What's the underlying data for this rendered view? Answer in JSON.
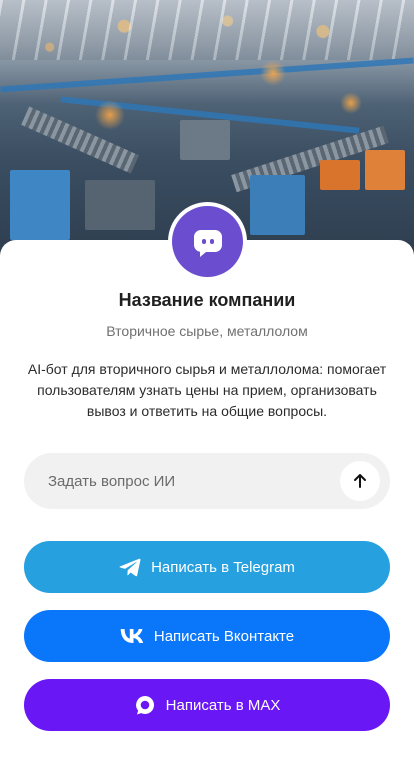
{
  "hero": {
    "image_alt": "Recycling plant"
  },
  "company": {
    "name": "Название компании",
    "category": "Вторичное сырье, металлолом",
    "description": "AI-бот для вторичного сырья и металлолома: помогает пользователям узнать цены на прием, организовать вывоз и ответить на общие вопросы."
  },
  "ask": {
    "placeholder": "Задать вопрос ИИ",
    "value": ""
  },
  "buttons": {
    "telegram": {
      "label": "Написать в Telegram",
      "color": "#27a0df",
      "icon": "telegram-icon"
    },
    "vk": {
      "label": "Написать Вконтакте",
      "color": "#0a77fb",
      "icon": "vk-icon"
    },
    "max": {
      "label": "Написать в MAX",
      "color": "#6a17f5",
      "icon": "max-icon"
    }
  },
  "colors": {
    "avatar": "#6a4ecf",
    "input_bg": "#f1f1f2"
  }
}
